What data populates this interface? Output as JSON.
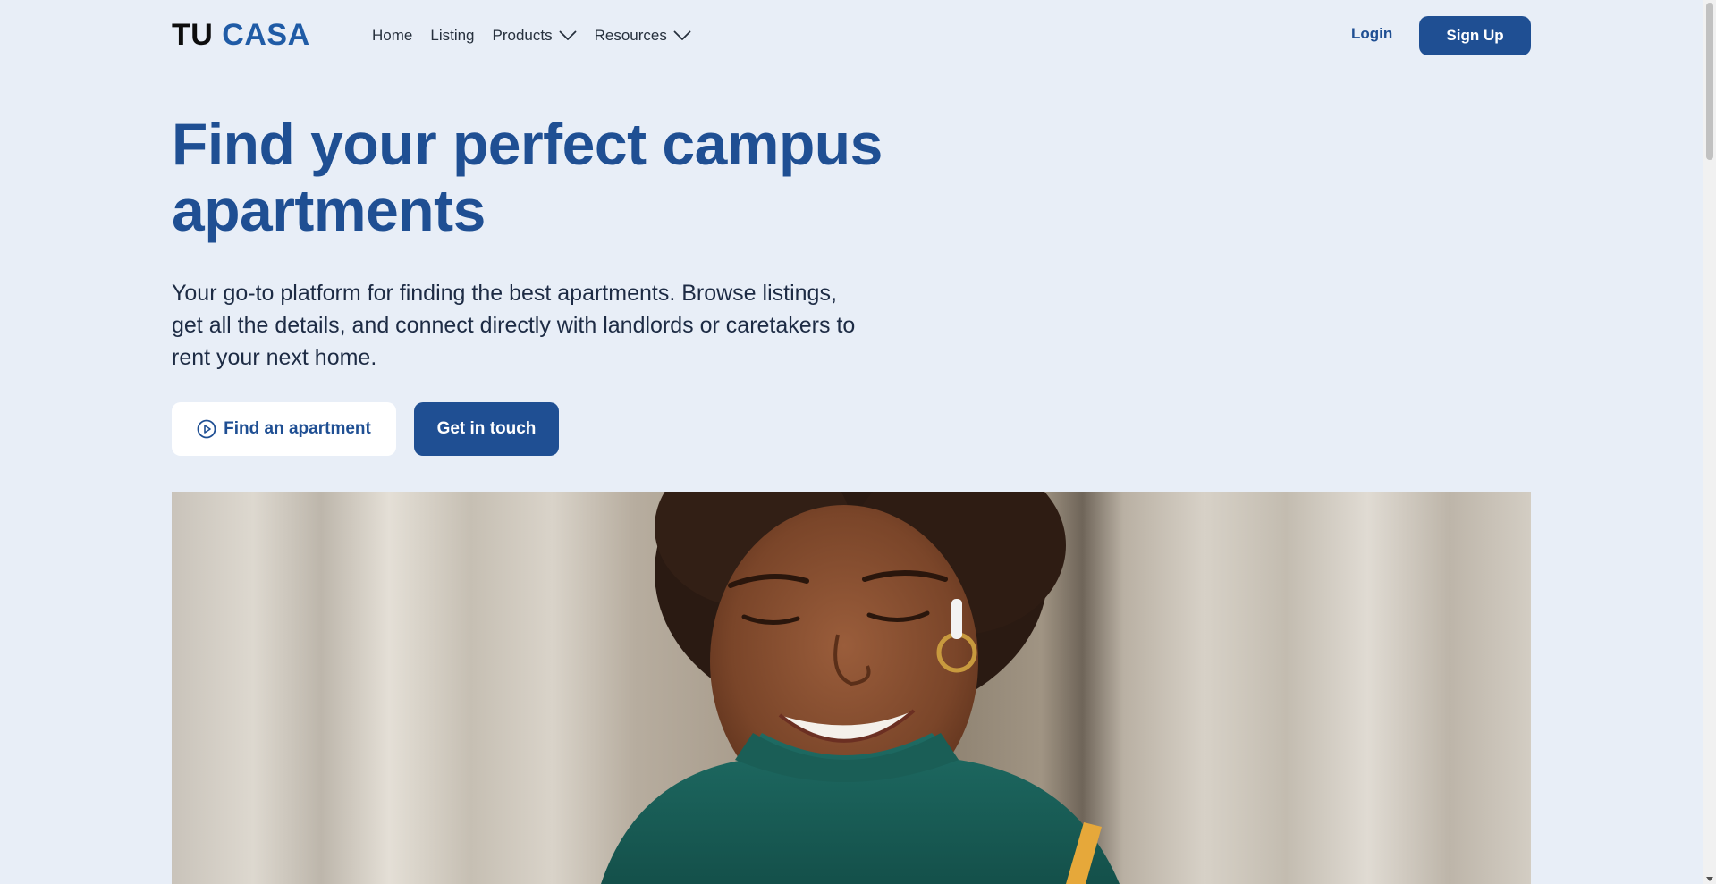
{
  "brand": {
    "part1": "TU",
    "part2": "CASA",
    "dark_color": "#0d0d0d",
    "accent_color": "#1f5ba6"
  },
  "nav": {
    "items": [
      {
        "label": "Home",
        "has_dropdown": false
      },
      {
        "label": "Listing",
        "has_dropdown": false
      },
      {
        "label": "Products",
        "has_dropdown": true,
        "icon": "chevron-down-icon"
      },
      {
        "label": "Resources",
        "has_dropdown": true,
        "icon": "chevron-down-icon"
      }
    ],
    "login_label": "Login",
    "signup_label": "Sign Up"
  },
  "hero": {
    "title_line1": "Find your perfect campus",
    "title_line2": "apartments",
    "subtitle": "Your go-to platform for finding the best apartments. Browse listings, get all the details, and connect directly with landlords or caretakers to rent your next home.",
    "primary_button": {
      "label": "Find an apartment",
      "icon": "play-circle-icon"
    },
    "secondary_button": {
      "label": "Get in touch"
    }
  },
  "colors": {
    "background": "#e8eef7",
    "primary": "#1f4f93",
    "text": "#1d2b44"
  }
}
